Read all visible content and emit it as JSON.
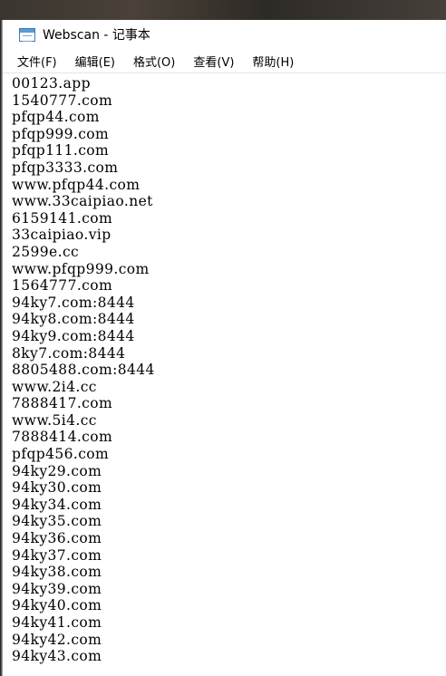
{
  "window": {
    "title": "Webscan - 记事本",
    "app_icon": "notepad-icon"
  },
  "menu": {
    "items": [
      "文件(F)",
      "编辑(E)",
      "格式(O)",
      "查看(V)",
      "帮助(H)"
    ]
  },
  "editor": {
    "lines": [
      "00123.app",
      "1540777.com",
      "pfqp44.com",
      "pfqp999.com",
      "pfqp111.com",
      "pfqp3333.com",
      "www.pfqp44.com",
      "www.33caipiao.net",
      "6159141.com",
      "33caipiao.vip",
      "2599e.cc",
      "www.pfqp999.com",
      "1564777.com",
      "94ky7.com:8444",
      "94ky8.com:8444",
      "94ky9.com:8444",
      "8ky7.com:8444",
      "8805488.com:8444",
      "www.2i4.cc",
      "7888417.com",
      "www.5i4.cc",
      "7888414.com",
      "pfqp456.com",
      "94ky29.com",
      "94ky30.com",
      "94ky34.com",
      "94ky35.com",
      "94ky36.com",
      "94ky37.com",
      "94ky38.com",
      "94ky39.com",
      "94ky40.com",
      "94ky41.com",
      "94ky42.com",
      "94ky43.com"
    ]
  }
}
